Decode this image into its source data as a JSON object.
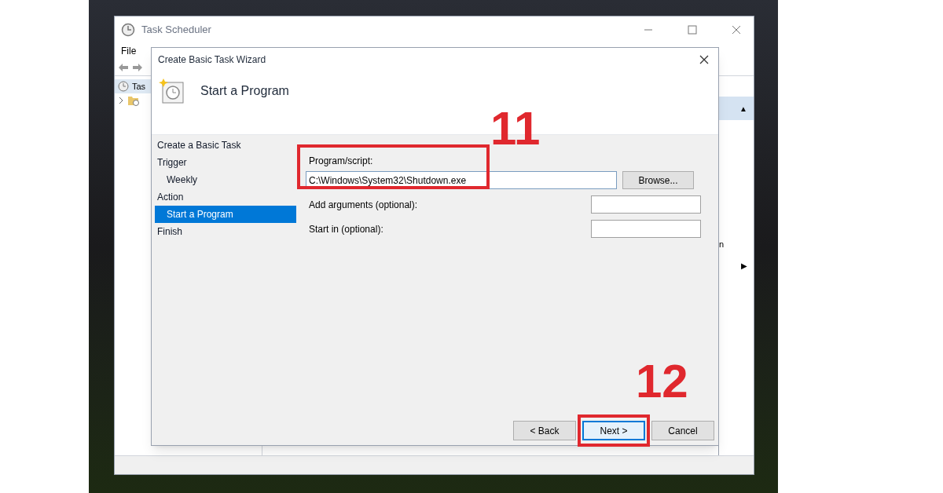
{
  "task_scheduler": {
    "title": "Task Scheduler",
    "menu": [
      "File"
    ],
    "tree": [
      {
        "label": "Tas"
      }
    ],
    "right_pane": {
      "header_arrow": "▲",
      "fragment": "n",
      "item_arrow": "▶"
    }
  },
  "wizard": {
    "title": "Create Basic Task Wizard",
    "heading": "Start a Program",
    "steps": [
      {
        "label": "Create a Basic Task",
        "selected": false
      },
      {
        "label": "Trigger",
        "selected": false,
        "children": [
          {
            "label": "Weekly",
            "selected": false
          }
        ]
      },
      {
        "label": "Action",
        "selected": false,
        "children": [
          {
            "label": "Start a Program",
            "selected": true
          }
        ]
      },
      {
        "label": "Finish",
        "selected": false
      }
    ],
    "program_annotation": "11",
    "program_label": "Program/script:",
    "program_value": "C:\\Windows\\System32\\Shutdown.exe",
    "browse": "Browse...",
    "fields": [
      {
        "label": "Add arguments (optional):"
      },
      {
        "label": "Start in (optional):"
      }
    ],
    "buttons": [
      {
        "label": "< Back",
        "default": false
      },
      {
        "label": "Next >",
        "default": true,
        "annotation": "12"
      },
      {
        "label": "Cancel",
        "default": false
      }
    ]
  }
}
